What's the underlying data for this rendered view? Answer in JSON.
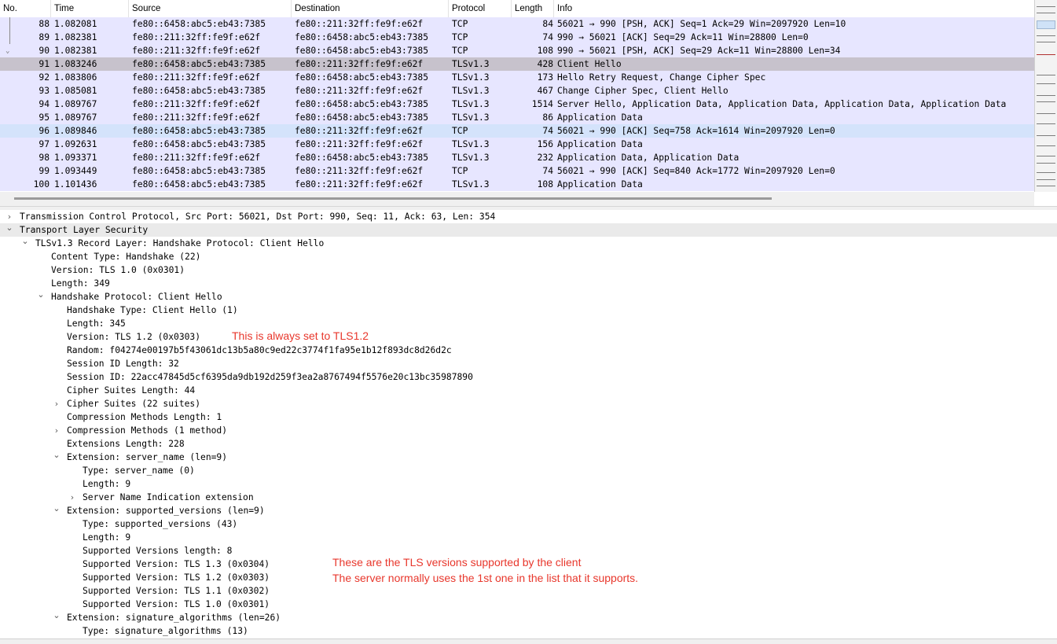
{
  "columns": {
    "no": "No.",
    "time": "Time",
    "source": "Source",
    "destination": "Destination",
    "protocol": "Protocol",
    "length": "Length",
    "info": "Info"
  },
  "packets": [
    {
      "no": "88",
      "time": "1.082081",
      "source": "fe80::6458:abc5:eb43:7385",
      "destination": "fe80::211:32ff:fe9f:e62f",
      "protocol": "TCP",
      "length": "84",
      "info": "56021 → 990 [PSH, ACK] Seq=1 Ack=29 Win=2097920 Len=10"
    },
    {
      "no": "89",
      "time": "1.082381",
      "source": "fe80::211:32ff:fe9f:e62f",
      "destination": "fe80::6458:abc5:eb43:7385",
      "protocol": "TCP",
      "length": "74",
      "info": "990 → 56021 [ACK] Seq=29 Ack=11 Win=28800 Len=0"
    },
    {
      "no": "90",
      "time": "1.082381",
      "source": "fe80::211:32ff:fe9f:e62f",
      "destination": "fe80::6458:abc5:eb43:7385",
      "protocol": "TCP",
      "length": "108",
      "info": "990 → 56021 [PSH, ACK] Seq=29 Ack=11 Win=28800 Len=34"
    },
    {
      "no": "91",
      "time": "1.083246",
      "source": "fe80::6458:abc5:eb43:7385",
      "destination": "fe80::211:32ff:fe9f:e62f",
      "protocol": "TLSv1.3",
      "length": "428",
      "info": "Client Hello"
    },
    {
      "no": "92",
      "time": "1.083806",
      "source": "fe80::211:32ff:fe9f:e62f",
      "destination": "fe80::6458:abc5:eb43:7385",
      "protocol": "TLSv1.3",
      "length": "173",
      "info": "Hello Retry Request, Change Cipher Spec"
    },
    {
      "no": "93",
      "time": "1.085081",
      "source": "fe80::6458:abc5:eb43:7385",
      "destination": "fe80::211:32ff:fe9f:e62f",
      "protocol": "TLSv1.3",
      "length": "467",
      "info": "Change Cipher Spec, Client Hello"
    },
    {
      "no": "94",
      "time": "1.089767",
      "source": "fe80::211:32ff:fe9f:e62f",
      "destination": "fe80::6458:abc5:eb43:7385",
      "protocol": "TLSv1.3",
      "length": "1514",
      "info": "Server Hello, Application Data, Application Data, Application Data, Application Data"
    },
    {
      "no": "95",
      "time": "1.089767",
      "source": "fe80::211:32ff:fe9f:e62f",
      "destination": "fe80::6458:abc5:eb43:7385",
      "protocol": "TLSv1.3",
      "length": "86",
      "info": "Application Data"
    },
    {
      "no": "96",
      "time": "1.089846",
      "source": "fe80::6458:abc5:eb43:7385",
      "destination": "fe80::211:32ff:fe9f:e62f",
      "protocol": "TCP",
      "length": "74",
      "info": "56021 → 990 [ACK] Seq=758 Ack=1614 Win=2097920 Len=0"
    },
    {
      "no": "97",
      "time": "1.092631",
      "source": "fe80::6458:abc5:eb43:7385",
      "destination": "fe80::211:32ff:fe9f:e62f",
      "protocol": "TLSv1.3",
      "length": "156",
      "info": "Application Data"
    },
    {
      "no": "98",
      "time": "1.093371",
      "source": "fe80::211:32ff:fe9f:e62f",
      "destination": "fe80::6458:abc5:eb43:7385",
      "protocol": "TLSv1.3",
      "length": "232",
      "info": "Application Data, Application Data"
    },
    {
      "no": "99",
      "time": "1.093449",
      "source": "fe80::6458:abc5:eb43:7385",
      "destination": "fe80::211:32ff:fe9f:e62f",
      "protocol": "TCP",
      "length": "74",
      "info": "56021 → 990 [ACK] Seq=840 Ack=1772 Win=2097920 Len=0"
    },
    {
      "no": "100",
      "time": "1.101436",
      "source": "fe80::6458:abc5:eb43:7385",
      "destination": "fe80::211:32ff:fe9f:e62f",
      "protocol": "TLSv1.3",
      "length": "108",
      "info": "Application Data"
    }
  ],
  "tree": [
    {
      "level": 0,
      "toggle": "collapsed",
      "text": "Transmission Control Protocol, Src Port: 56021, Dst Port: 990, Seq: 11, Ack: 63, Len: 354"
    },
    {
      "level": 0,
      "toggle": "expanded",
      "text": "Transport Layer Security"
    },
    {
      "level": 1,
      "toggle": "expanded",
      "text": "TLSv1.3 Record Layer: Handshake Protocol: Client Hello"
    },
    {
      "level": 2,
      "toggle": "none",
      "text": "Content Type: Handshake (22)"
    },
    {
      "level": 2,
      "toggle": "none",
      "text": "Version: TLS 1.0 (0x0301)"
    },
    {
      "level": 2,
      "toggle": "none",
      "text": "Length: 349"
    },
    {
      "level": 2,
      "toggle": "expanded",
      "text": "Handshake Protocol: Client Hello"
    },
    {
      "level": 3,
      "toggle": "none",
      "text": "Handshake Type: Client Hello (1)"
    },
    {
      "level": 3,
      "toggle": "none",
      "text": "Length: 345"
    },
    {
      "level": 3,
      "toggle": "none",
      "text": "Version: TLS 1.2 (0x0303)"
    },
    {
      "level": 3,
      "toggle": "none",
      "text": "Random: f04274e00197b5f43061dc13b5a80c9ed22c3774f1fa95e1b12f893dc8d26d2c"
    },
    {
      "level": 3,
      "toggle": "none",
      "text": "Session ID Length: 32"
    },
    {
      "level": 3,
      "toggle": "none",
      "text": "Session ID: 22acc47845d5cf6395da9db192d259f3ea2a8767494f5576e20c13bc35987890"
    },
    {
      "level": 3,
      "toggle": "none",
      "text": "Cipher Suites Length: 44"
    },
    {
      "level": 3,
      "toggle": "collapsed",
      "text": "Cipher Suites (22 suites)"
    },
    {
      "level": 3,
      "toggle": "none",
      "text": "Compression Methods Length: 1"
    },
    {
      "level": 3,
      "toggle": "collapsed",
      "text": "Compression Methods (1 method)"
    },
    {
      "level": 3,
      "toggle": "none",
      "text": "Extensions Length: 228"
    },
    {
      "level": 3,
      "toggle": "expanded",
      "text": "Extension: server_name (len=9)"
    },
    {
      "level": 4,
      "toggle": "none",
      "text": "Type: server_name (0)"
    },
    {
      "level": 4,
      "toggle": "none",
      "text": "Length: 9"
    },
    {
      "level": 4,
      "toggle": "collapsed",
      "text": "Server Name Indication extension"
    },
    {
      "level": 3,
      "toggle": "expanded",
      "text": "Extension: supported_versions (len=9)"
    },
    {
      "level": 4,
      "toggle": "none",
      "text": "Type: supported_versions (43)"
    },
    {
      "level": 4,
      "toggle": "none",
      "text": "Length: 9"
    },
    {
      "level": 4,
      "toggle": "none",
      "text": "Supported Versions length: 8"
    },
    {
      "level": 4,
      "toggle": "none",
      "text": "Supported Version: TLS 1.3 (0x0304)"
    },
    {
      "level": 4,
      "toggle": "none",
      "text": "Supported Version: TLS 1.2 (0x0303)"
    },
    {
      "level": 4,
      "toggle": "none",
      "text": "Supported Version: TLS 1.1 (0x0302)"
    },
    {
      "level": 4,
      "toggle": "none",
      "text": "Supported Version: TLS 1.0 (0x0301)"
    },
    {
      "level": 3,
      "toggle": "expanded",
      "text": "Extension: signature_algorithms (len=26)"
    },
    {
      "level": 4,
      "toggle": "none",
      "text": "Type: signature_algorithms (13)"
    }
  ],
  "annotations": {
    "version_note": "This is always set to TLS1.2",
    "versions_note_line1": "These are the TLS versions supported by the client",
    "versions_note_line2": "The server normally uses the 1st one in the list that it supports."
  },
  "colors": {
    "row_bg": "#e7e6ff",
    "selected_row_bg": "#c7c2cc",
    "related_row_bg": "#d4e3fb",
    "annotation_red": "#e8372c"
  },
  "icons": {
    "collapsed": "chevron-right-icon",
    "expanded": "chevron-down-icon"
  }
}
